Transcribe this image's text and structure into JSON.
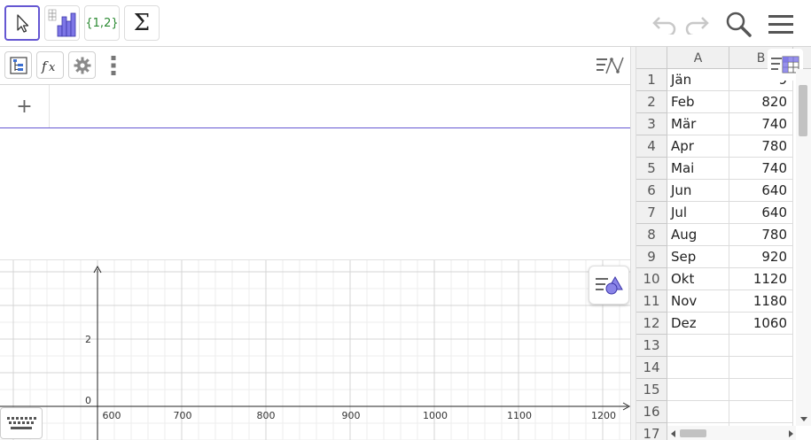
{
  "toolbar": {
    "tools": [
      {
        "name": "move-tool"
      },
      {
        "name": "histogram-tool"
      },
      {
        "name": "list-tool",
        "label": "{1,2}"
      },
      {
        "name": "sum-tool",
        "label": "Σ"
      }
    ],
    "accent": "#6557d2"
  },
  "algebra": {
    "input_plus": "+"
  },
  "graphics": {
    "x_ticks": [
      "600",
      "700",
      "800",
      "900",
      "1000",
      "1100",
      "1200"
    ],
    "y_ticks": [
      "2",
      "0"
    ]
  },
  "sheet": {
    "columns": [
      "A",
      "B"
    ],
    "rows": [
      {
        "n": "1",
        "a": "Jän",
        "b": "9"
      },
      {
        "n": "2",
        "a": "Feb",
        "b": "820"
      },
      {
        "n": "3",
        "a": "Mär",
        "b": "740"
      },
      {
        "n": "4",
        "a": "Apr",
        "b": "780"
      },
      {
        "n": "5",
        "a": "Mai",
        "b": "740"
      },
      {
        "n": "6",
        "a": "Jun",
        "b": "640"
      },
      {
        "n": "7",
        "a": "Jul",
        "b": "640"
      },
      {
        "n": "8",
        "a": "Aug",
        "b": "780"
      },
      {
        "n": "9",
        "a": "Sep",
        "b": "920"
      },
      {
        "n": "10",
        "a": "Okt",
        "b": "1120"
      },
      {
        "n": "11",
        "a": "Nov",
        "b": "1180"
      },
      {
        "n": "12",
        "a": "Dez",
        "b": "1060"
      },
      {
        "n": "13",
        "a": "",
        "b": ""
      },
      {
        "n": "14",
        "a": "",
        "b": ""
      },
      {
        "n": "15",
        "a": "",
        "b": ""
      },
      {
        "n": "16",
        "a": "",
        "b": ""
      },
      {
        "n": "17",
        "a": "",
        "b": ""
      }
    ]
  }
}
